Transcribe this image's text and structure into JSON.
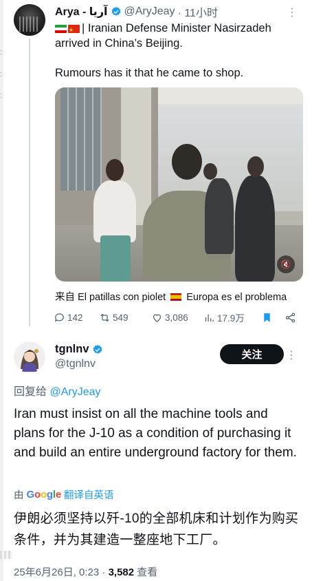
{
  "tweet1": {
    "display_name": "Arya - آریا",
    "handle": "@AryJeay",
    "time": "· 11小时",
    "text_line1": "| Iranian Defense Minister Nasirzadeh arrived in China’s Beijing.",
    "text_line2": "Rumours has it that he came to shop.",
    "source_prefix": "来自",
    "source_account": "El patillas con piolet",
    "source_suffix": "Europa es el problema",
    "replies": "142",
    "reposts": "549",
    "likes": "3,086",
    "views": "17.9万"
  },
  "tweet2": {
    "display_name": "tgnlnv",
    "handle": "@tgnlnv",
    "follow_label": "关注",
    "reply_prefix": "回复给",
    "reply_handle": "@AryJeay",
    "text": "Iran must insist on all the machine tools and plans for the J-10 as a condition of purchasing it and build an entire underground factory for them.",
    "translated_by_prefix": "由",
    "translate_label": "翻译自英语",
    "translated_text": "伊朗必须坚持以歼-10的全部机床和计划作为购买条件，并为其建造一整座地下工厂。",
    "date": "25年6月26日, 0:23 ·",
    "view_count": "3,582",
    "view_label": "查看"
  },
  "colors": {
    "accent": "#1d9bf0",
    "text": "#0f1419",
    "muted": "#536471"
  }
}
